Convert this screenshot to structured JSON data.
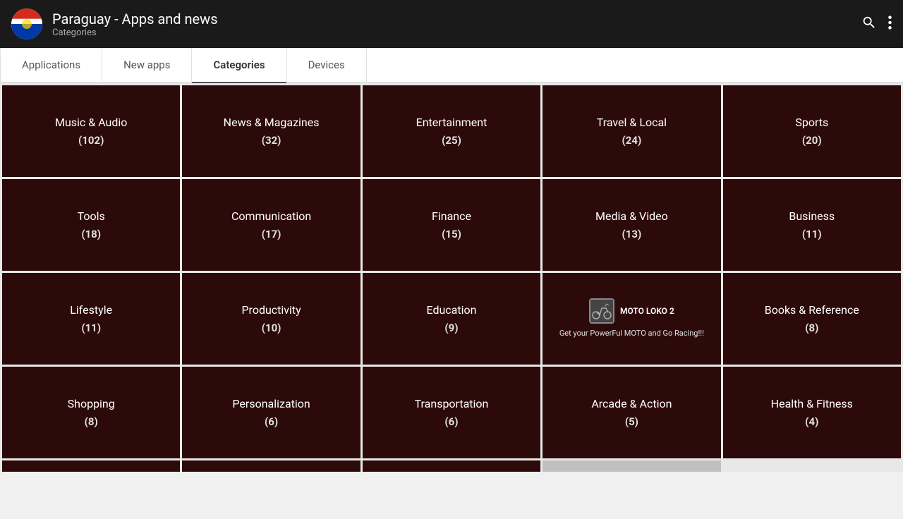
{
  "header": {
    "title": "Paraguay - Apps and news",
    "subtitle": "Categories",
    "flag_alt": "Paraguay flag"
  },
  "nav": {
    "tabs": [
      {
        "id": "applications",
        "label": "Applications",
        "active": false
      },
      {
        "id": "new-apps",
        "label": "New apps",
        "active": false
      },
      {
        "id": "categories",
        "label": "Categories",
        "active": true
      },
      {
        "id": "devices",
        "label": "Devices",
        "active": false
      }
    ]
  },
  "categories": [
    {
      "name": "Music & Audio",
      "count": "(102)"
    },
    {
      "name": "News & Magazines",
      "count": "(32)"
    },
    {
      "name": "Entertainment",
      "count": "(25)"
    },
    {
      "name": "Travel & Local",
      "count": "(24)"
    },
    {
      "name": "Sports",
      "count": "(20)"
    },
    {
      "name": "Tools",
      "count": "(18)"
    },
    {
      "name": "Communication",
      "count": "(17)"
    },
    {
      "name": "Finance",
      "count": "(15)"
    },
    {
      "name": "Media & Video",
      "count": "(13)"
    },
    {
      "name": "Business",
      "count": "(11)"
    },
    {
      "name": "Lifestyle",
      "count": "(11)"
    },
    {
      "name": "Productivity",
      "count": "(10)"
    },
    {
      "name": "Education",
      "count": "(9)"
    },
    {
      "name": "__ad__",
      "count": "",
      "ad_title": "MOTO LOKO 2",
      "ad_text": "Get your PowerFul MOTO and Go Racing!!!"
    },
    {
      "name": "Books & Reference",
      "count": "(8)"
    },
    {
      "name": "Shopping",
      "count": "(8)"
    },
    {
      "name": "Personalization",
      "count": "(6)"
    },
    {
      "name": "Transportation",
      "count": "(6)"
    },
    {
      "name": "Arcade & Action",
      "count": "(5)"
    },
    {
      "name": "Health & Fitness",
      "count": "(4)"
    }
  ],
  "icons": {
    "search": "🔍",
    "more": "⋮"
  }
}
